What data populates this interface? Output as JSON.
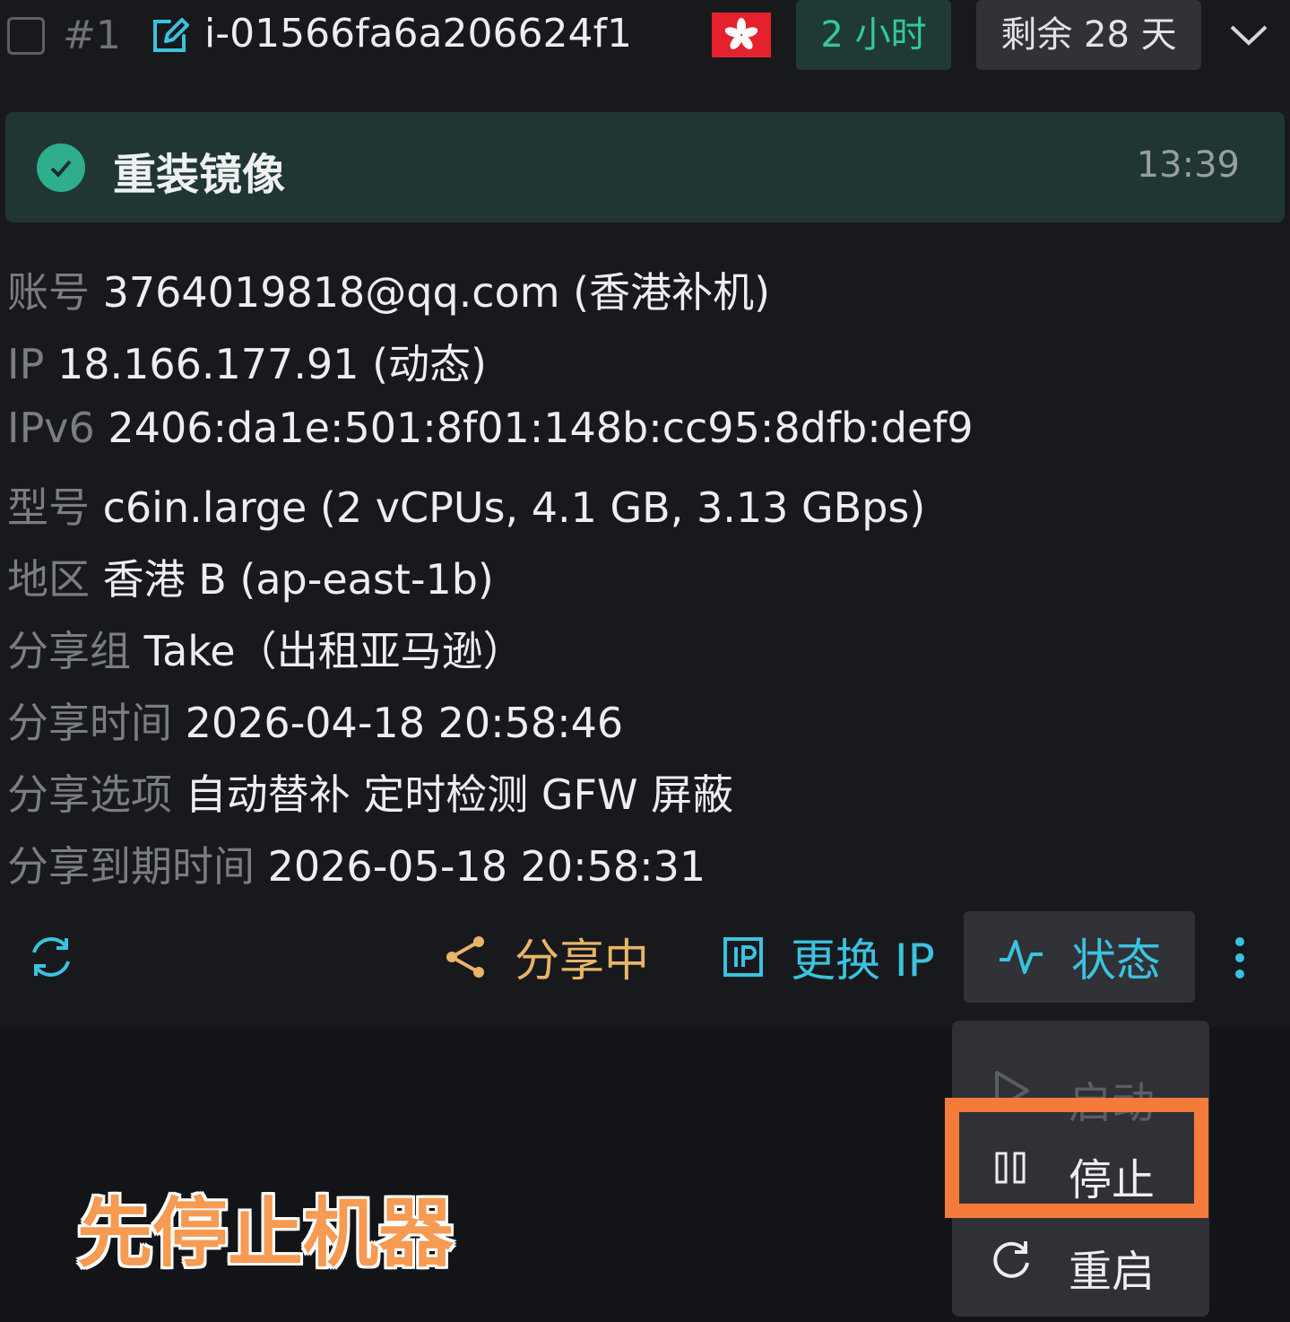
{
  "header": {
    "index": "#1",
    "instance_id": "i-01566fa6a206624f1",
    "flag_icon": "hong-kong-flag-icon",
    "uptime_tag": "2 小时",
    "remaining_tag": "剩余 28 天"
  },
  "banner": {
    "text": "重装镜像",
    "time": "13:39"
  },
  "info": [
    {
      "label": "账号",
      "value": "3764019818@qq.com (香港补机)"
    },
    {
      "label": "IP",
      "value": "18.166.177.91 (动态)"
    },
    {
      "label": "IPv6",
      "value": "2406:da1e:501:8f01:148b:cc95:8dfb:def9"
    },
    {
      "label": "型号",
      "value": "c6in.large (2 vCPUs, 4.1 GB, 3.13 GBps)"
    },
    {
      "label": "地区",
      "value": "香港 B (ap-east-1b)"
    },
    {
      "label": "分享组",
      "value": "Take（出租亚马逊）"
    },
    {
      "label": "分享时间",
      "value": "2026-04-18 20:58:46"
    },
    {
      "label": "分享选项",
      "value": "自动替补  定时检测 GFW 屏蔽"
    },
    {
      "label": "分享到期时间",
      "value": "2026-05-18 20:58:31"
    }
  ],
  "actions": {
    "share": "分享中",
    "change_ip": "更换 IP",
    "status": "状态"
  },
  "menu": {
    "start": "启动",
    "stop": "停止",
    "restart": "重启"
  },
  "annotation": "先停止机器",
  "colors": {
    "accent": "#3ac3de",
    "success": "#35c7a1",
    "share": "#e8b567",
    "highlight": "#f47b3a"
  }
}
